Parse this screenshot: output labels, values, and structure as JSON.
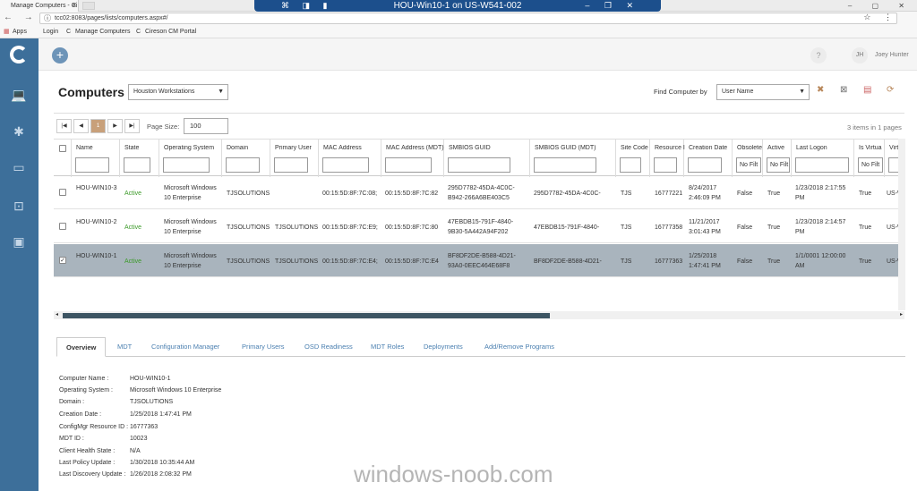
{
  "browser": {
    "tab_title": "Manage Computers - Ci",
    "url": "tcc02:8083/pages/lists/computers.aspx#/",
    "bookmarks": [
      "Apps",
      "Login",
      "Manage Computers",
      "Cireson CM Portal"
    ]
  },
  "rdp": {
    "title": "HOU-Win10-1 on US-W541-002"
  },
  "header": {
    "avatar_initials": "JH",
    "user_name": "Joey Hunter",
    "help": "?"
  },
  "page": {
    "title": "Computers",
    "collection": "Houston Workstations",
    "find_label": "Find Computer by",
    "find_by": "User Name"
  },
  "pager": {
    "current_page": "1",
    "page_size_label": "Page Size:",
    "page_size": "100",
    "summary": "3 items in 1 pages"
  },
  "columns": [
    "Name",
    "State",
    "Operating System",
    "Domain",
    "Primary User",
    "MAC Address",
    "MAC Address (MDT)",
    "SMBIOS GUID",
    "SMBIOS GUID (MDT)",
    "Site Code",
    "Resource I",
    "Creation Date",
    "Obsolete",
    "Active",
    "Last Logon",
    "Is Virtua",
    "Virtu"
  ],
  "filters": {
    "obsolete": "No Filt",
    "active": "No Filt",
    "virtual": "No Filt"
  },
  "rows": [
    {
      "name": "HOU-WIN10-3",
      "state": "Active",
      "os": "Microsoft Windows 10 Enterprise",
      "domain": "TJSOLUTIONS",
      "user": "",
      "mac": "00:15:5D:8F:7C:08;",
      "mac_mdt": "00:15:5D:8F:7C:82",
      "guid": "295D7782-45DA-4C0C-B942-266A6BE403C5",
      "guid_mdt": "295D7782-45DA-4C0C-B942-",
      "site": "TJS",
      "resource": "16777221",
      "created": "8/24/2017 2:46:09 PM",
      "obsolete": "False",
      "active": "True",
      "last_logon": "1/23/2018 2:17:55 PM",
      "virtual": "True",
      "virt": "US-W"
    },
    {
      "name": "HOU-WIN10-2",
      "state": "Active",
      "os": "Microsoft Windows 10 Enterprise",
      "domain": "TJSOLUTIONS",
      "user": "TJSOLUTIONS\\j",
      "mac": "00:15:5D:8F:7C:E9;",
      "mac_mdt": "00:15:5D:8F:7C:80",
      "guid": "47EBDB15-791F-4840-9B30-5A442A94F202",
      "guid_mdt": "47EBDB15-791F-4840-9B30-",
      "site": "TJS",
      "resource": "16777358",
      "created": "11/21/2017 3:01:43 PM",
      "obsolete": "False",
      "active": "True",
      "last_logon": "1/23/2018 2:14:57 PM",
      "virtual": "True",
      "virt": "US-W"
    },
    {
      "name": "HOU-WIN10-1",
      "state": "Active",
      "os": "Microsoft Windows 10 Enterprise",
      "domain": "TJSOLUTIONS",
      "user": "TJSOLUTIONS\\j",
      "mac": "00:15:5D:8F:7C:E4;",
      "mac_mdt": "00:15:5D:8F:7C:E4",
      "guid": "BF8DF2DE-B588-4D21-93A0-0EEC464E68F8",
      "guid_mdt": "BF8DF2DE-B588-4D21-93A0",
      "site": "TJS",
      "resource": "16777363",
      "created": "1/25/2018 1:47:41 PM",
      "obsolete": "False",
      "active": "True",
      "last_logon": "1/1/0001 12:00:00 AM",
      "virtual": "True",
      "virt": "US-W"
    }
  ],
  "detail_tabs": [
    "Overview",
    "MDT",
    "Configuration Manager",
    "Primary Users",
    "OSD Readiness",
    "MDT Roles",
    "Deployments",
    "Add/Remove Programs"
  ],
  "details": [
    {
      "label": "Computer Name :",
      "value": "HOU-WIN10-1"
    },
    {
      "label": "Operating System :",
      "value": "Microsoft Windows 10 Enterprise"
    },
    {
      "label": "Domain :",
      "value": "TJSOLUTIONS"
    },
    {
      "label": "Creation Date :",
      "value": "1/25/2018 1:47:41 PM"
    },
    {
      "label": "ConfigMgr Resource ID :",
      "value": "16777363"
    },
    {
      "label": "MDT ID :",
      "value": "10023"
    },
    {
      "label": "Client Health State :",
      "value": "N/A"
    },
    {
      "label": "Last Policy Update :",
      "value": "1/30/2018 10:35:44 AM"
    },
    {
      "label": "Last Discovery Update :",
      "value": "1/26/2018 2:08:32 PM"
    }
  ],
  "watermark": "windows-noob.com",
  "colors": {
    "sidebar": "#3d6f9a",
    "rdp_bar": "#1c4f8c",
    "selected_row": "#a9b4bd",
    "active_state": "#3c9a29"
  }
}
